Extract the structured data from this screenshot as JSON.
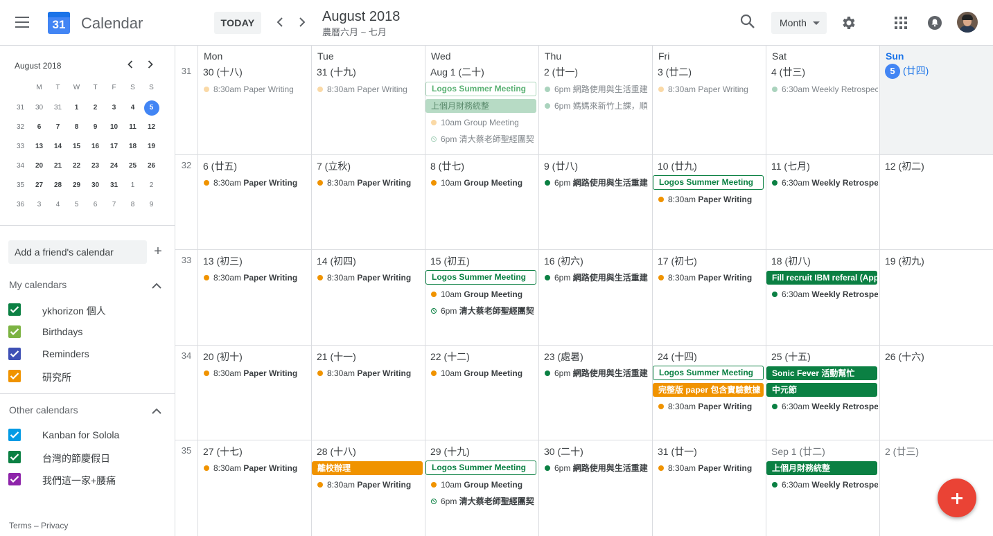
{
  "header": {
    "app_title": "Calendar",
    "logo_day": "31",
    "today_label": "TODAY",
    "prev_icon": "chevron-left",
    "next_icon": "chevron-right",
    "month_title": "August 2018",
    "lunar_subtitle": "農曆六月 ~ 七月",
    "view_select": "Month"
  },
  "mini_calendar": {
    "title": "August 2018",
    "dow": [
      "M",
      "T",
      "W",
      "T",
      "F",
      "S",
      "S"
    ],
    "weeks": [
      {
        "wk": "31",
        "days": [
          "30",
          "31",
          "1",
          "2",
          "3",
          "4",
          "5"
        ]
      },
      {
        "wk": "32",
        "days": [
          "6",
          "7",
          "8",
          "9",
          "10",
          "11",
          "12"
        ]
      },
      {
        "wk": "33",
        "days": [
          "13",
          "14",
          "15",
          "16",
          "17",
          "18",
          "19"
        ]
      },
      {
        "wk": "34",
        "days": [
          "20",
          "21",
          "22",
          "23",
          "24",
          "25",
          "26"
        ]
      },
      {
        "wk": "35",
        "days": [
          "27",
          "28",
          "29",
          "30",
          "31",
          "1",
          "2"
        ]
      },
      {
        "wk": "36",
        "days": [
          "3",
          "4",
          "5",
          "6",
          "7",
          "8",
          "9"
        ]
      }
    ]
  },
  "sidebar": {
    "add_friend_placeholder": "Add a friend's calendar",
    "my_calendars_title": "My calendars",
    "my_calendars": [
      {
        "label": "ykhorizon 個人",
        "color": "#0b8043"
      },
      {
        "label": "Birthdays",
        "color": "#7cb342"
      },
      {
        "label": "Reminders",
        "color": "#3f51b5"
      },
      {
        "label": "研究所",
        "color": "#f09300"
      }
    ],
    "other_calendars_title": "Other calendars",
    "other_calendars": [
      {
        "label": "Kanban for Solola",
        "color": "#039be5"
      },
      {
        "label": "台灣的節慶假日",
        "color": "#0b8043"
      },
      {
        "label": "我們這一家+腰痛",
        "color": "#8e24aa"
      }
    ],
    "footer": "Terms – Privacy"
  },
  "colors": {
    "green": "#0b8043",
    "orange": "#f09300",
    "blue": "#4285f4",
    "red_fab": "#ea4335"
  },
  "grid": {
    "dow": [
      "Mon",
      "Tue",
      "Wed",
      "Thu",
      "Fri",
      "Sat",
      "Sun"
    ],
    "weeks": [
      {
        "wk": "31",
        "days": [
          {
            "label": "30 (十八)",
            "events": [
              {
                "type": "dot",
                "color": "orange",
                "time": "8:30am",
                "name": "Paper Writing",
                "past": true
              }
            ]
          },
          {
            "label": "31 (十九)",
            "events": [
              {
                "type": "dot",
                "color": "orange",
                "time": "8:30am",
                "name": "Paper Writing",
                "past": true
              }
            ]
          },
          {
            "label": "Aug 1 (二十)",
            "events": [
              {
                "type": "box",
                "name": "Logos Summer Meeting",
                "past": true
              },
              {
                "type": "fill",
                "color": "#b7dbc5",
                "text_color": "#5a8a6c",
                "name": "上個月財務統整"
              },
              {
                "type": "dot",
                "color": "orange",
                "time": "10am",
                "name": "Group Meeting",
                "past": true
              },
              {
                "type": "ring",
                "time": "6pm",
                "name": "清大蔡老師聖經團契",
                "past": true
              }
            ]
          },
          {
            "label": "2 (廿一)",
            "events": [
              {
                "type": "dot",
                "color": "green",
                "time": "6pm",
                "name": "網路使用與生活重建",
                "past": true
              },
              {
                "type": "dot",
                "color": "green",
                "time": "6pm",
                "name": "媽媽來新竹上課，順",
                "past": true
              }
            ]
          },
          {
            "label": "3 (廿二)",
            "events": [
              {
                "type": "dot",
                "color": "orange",
                "time": "8:30am",
                "name": "Paper Writing",
                "past": true
              }
            ]
          },
          {
            "label": "4 (廿三)",
            "events": [
              {
                "type": "dot",
                "color": "green",
                "time": "6:30am",
                "name": "Weekly Retrospec",
                "past": true
              }
            ]
          },
          {
            "label": "(廿四)",
            "today": "5",
            "events": []
          }
        ]
      },
      {
        "wk": "32",
        "days": [
          {
            "label": "6 (廿五)",
            "events": [
              {
                "type": "dot",
                "color": "orange",
                "time": "8:30am",
                "name": "Paper Writing"
              }
            ]
          },
          {
            "label": "7 (立秋)",
            "events": [
              {
                "type": "dot",
                "color": "orange",
                "time": "8:30am",
                "name": "Paper Writing"
              }
            ]
          },
          {
            "label": "8 (廿七)",
            "events": [
              {
                "type": "dot",
                "color": "orange",
                "time": "10am",
                "name": "Group Meeting"
              }
            ]
          },
          {
            "label": "9 (廿八)",
            "events": [
              {
                "type": "dot",
                "color": "green",
                "time": "6pm",
                "name": "網路使用與生活重建"
              }
            ]
          },
          {
            "label": "10 (廿九)",
            "events": [
              {
                "type": "box",
                "name": "Logos Summer Meeting"
              },
              {
                "type": "dot",
                "color": "orange",
                "time": "8:30am",
                "name": "Paper Writing"
              }
            ]
          },
          {
            "label": "11 (七月)",
            "events": [
              {
                "type": "dot",
                "color": "green",
                "time": "6:30am",
                "name": "Weekly Retrospec"
              }
            ]
          },
          {
            "label": "12 (初二)",
            "events": []
          }
        ]
      },
      {
        "wk": "33",
        "days": [
          {
            "label": "13 (初三)",
            "events": [
              {
                "type": "dot",
                "color": "orange",
                "time": "8:30am",
                "name": "Paper Writing"
              }
            ]
          },
          {
            "label": "14 (初四)",
            "events": [
              {
                "type": "dot",
                "color": "orange",
                "time": "8:30am",
                "name": "Paper Writing"
              }
            ]
          },
          {
            "label": "15 (初五)",
            "events": [
              {
                "type": "box",
                "name": "Logos Summer Meeting"
              },
              {
                "type": "dot",
                "color": "orange",
                "time": "10am",
                "name": "Group Meeting"
              },
              {
                "type": "ring",
                "time": "6pm",
                "name": "清大蔡老師聖經團契"
              }
            ]
          },
          {
            "label": "16 (初六)",
            "events": [
              {
                "type": "dot",
                "color": "green",
                "time": "6pm",
                "name": "網路使用與生活重建"
              }
            ]
          },
          {
            "label": "17 (初七)",
            "events": [
              {
                "type": "dot",
                "color": "orange",
                "time": "8:30am",
                "name": "Paper Writing"
              }
            ]
          },
          {
            "label": "18 (初八)",
            "events": [
              {
                "type": "fill",
                "color": "#0b8043",
                "name": "Fill recruit IBM referal (App"
              },
              {
                "type": "dot",
                "color": "green",
                "time": "6:30am",
                "name": "Weekly Retrospec"
              }
            ]
          },
          {
            "label": "19 (初九)",
            "events": []
          }
        ]
      },
      {
        "wk": "34",
        "days": [
          {
            "label": "20 (初十)",
            "events": [
              {
                "type": "dot",
                "color": "orange",
                "time": "8:30am",
                "name": "Paper Writing"
              }
            ]
          },
          {
            "label": "21 (十一)",
            "events": [
              {
                "type": "dot",
                "color": "orange",
                "time": "8:30am",
                "name": "Paper Writing"
              }
            ]
          },
          {
            "label": "22 (十二)",
            "events": [
              {
                "type": "dot",
                "color": "orange",
                "time": "10am",
                "name": "Group Meeting"
              }
            ]
          },
          {
            "label": "23 (處暑)",
            "events": [
              {
                "type": "dot",
                "color": "green",
                "time": "6pm",
                "name": "網路使用與生活重建"
              }
            ]
          },
          {
            "label": "24 (十四)",
            "events": [
              {
                "type": "box",
                "name": "Logos Summer Meeting"
              },
              {
                "type": "fill",
                "color": "#f09300",
                "name": "完整版 paper 包含實驗數據"
              },
              {
                "type": "dot",
                "color": "orange",
                "time": "8:30am",
                "name": "Paper Writing"
              }
            ]
          },
          {
            "label": "25 (十五)",
            "events": [
              {
                "type": "fill",
                "color": "#0b8043",
                "name": "Sonic Fever 活動幫忙"
              },
              {
                "type": "fill",
                "color": "#0b8043",
                "name": "中元節"
              },
              {
                "type": "dot",
                "color": "green",
                "time": "6:30am",
                "name": "Weekly Retrospec"
              }
            ]
          },
          {
            "label": "26 (十六)",
            "events": []
          }
        ]
      },
      {
        "wk": "35",
        "days": [
          {
            "label": "27 (十七)",
            "events": [
              {
                "type": "dot",
                "color": "orange",
                "time": "8:30am",
                "name": "Paper Writing"
              }
            ]
          },
          {
            "label": "28 (十八)",
            "events": [
              {
                "type": "fill",
                "color": "#f09300",
                "name": "離校辦理"
              },
              {
                "type": "dot",
                "color": "orange",
                "time": "8:30am",
                "name": "Paper Writing"
              }
            ]
          },
          {
            "label": "29 (十九)",
            "events": [
              {
                "type": "box",
                "name": "Logos Summer Meeting"
              },
              {
                "type": "dot",
                "color": "orange",
                "time": "10am",
                "name": "Group Meeting"
              },
              {
                "type": "ring",
                "time": "6pm",
                "name": "清大蔡老師聖經團契"
              }
            ]
          },
          {
            "label": "30 (二十)",
            "events": [
              {
                "type": "dot",
                "color": "green",
                "time": "6pm",
                "name": "網路使用與生活重建"
              }
            ]
          },
          {
            "label": "31 (廿一)",
            "events": [
              {
                "type": "dot",
                "color": "orange",
                "time": "8:30am",
                "name": "Paper Writing"
              }
            ]
          },
          {
            "label": "Sep 1 (廿二)",
            "other": true,
            "events": [
              {
                "type": "fill",
                "color": "#0b8043",
                "name": "上個月財務統整"
              },
              {
                "type": "dot",
                "color": "green",
                "time": "6:30am",
                "name": "Weekly Retrospec"
              }
            ]
          },
          {
            "label": "2 (廿三)",
            "other": true,
            "events": []
          }
        ]
      }
    ]
  },
  "fab_label": "+"
}
